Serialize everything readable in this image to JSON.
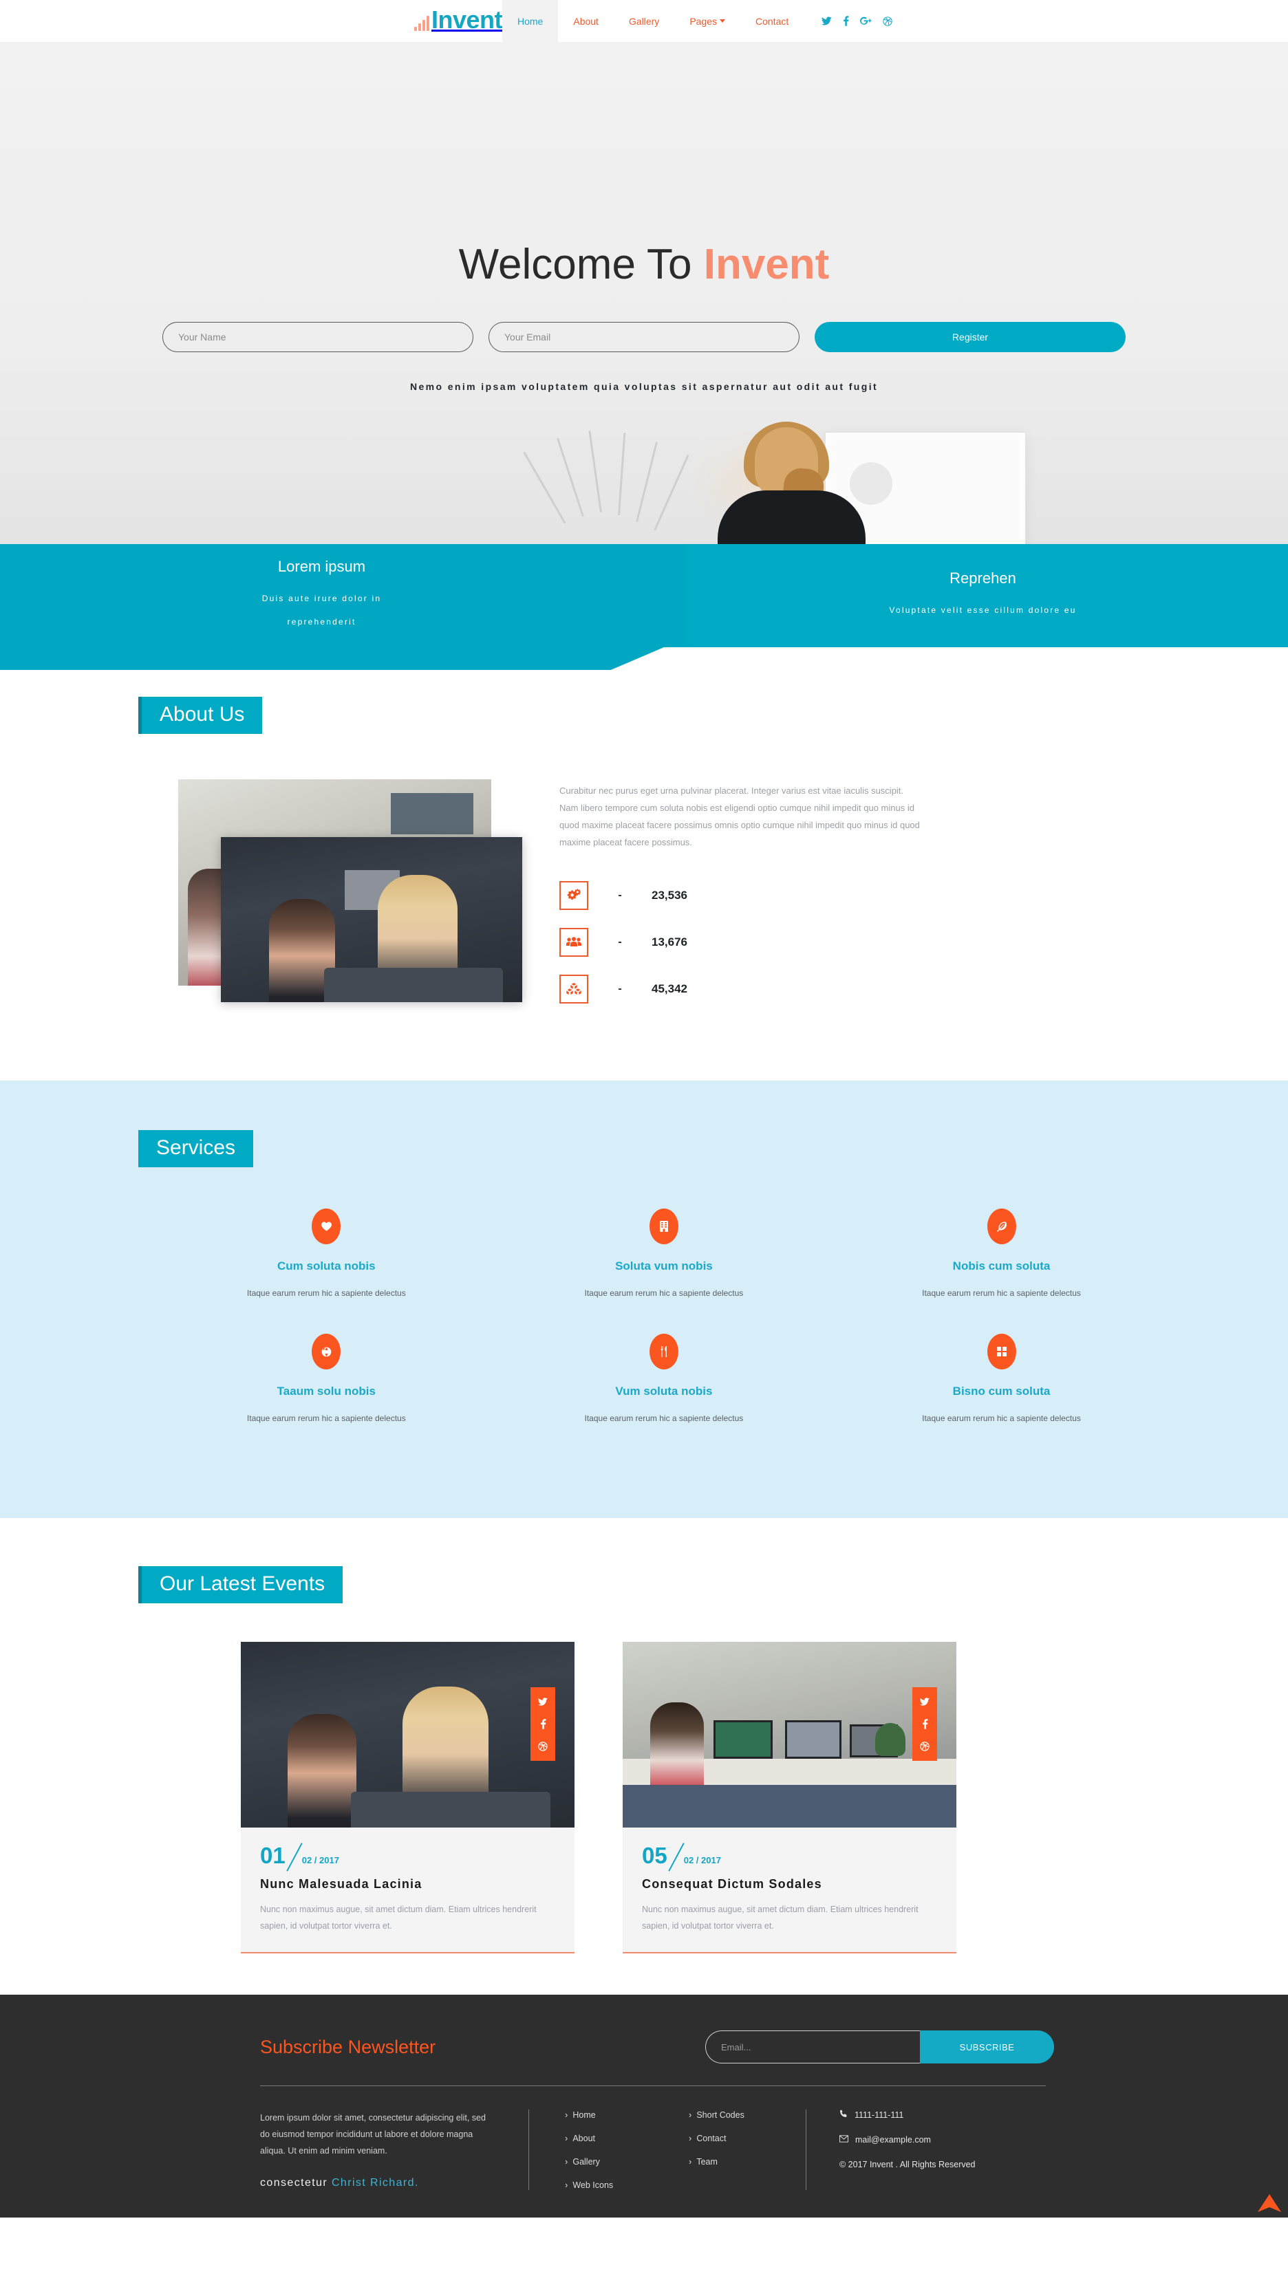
{
  "header": {
    "logo_text": "Invent",
    "nav": [
      {
        "label": "Home",
        "active": true
      },
      {
        "label": "About",
        "active": false
      },
      {
        "label": "Gallery",
        "active": false
      },
      {
        "label": "Pages",
        "active": false,
        "has_caret": true
      },
      {
        "label": "Contact",
        "active": false
      }
    ],
    "social": [
      "twitter-icon",
      "facebook-icon",
      "google-plus-icon",
      "dribbble-icon"
    ]
  },
  "hero": {
    "title_plain": "Welcome To ",
    "title_accent": "Invent",
    "name_placeholder": "Your Name",
    "email_placeholder": "Your Email",
    "name_value": "",
    "email_value": "",
    "register_label": "Register",
    "tagline": "Nemo enim ipsam voluptatem quia voluptas sit aspernatur aut odit aut fugit"
  },
  "banner": {
    "left": {
      "title": "Lorem ipsum",
      "line1": "Duis aute irure dolor in",
      "line2": "reprehenderit"
    },
    "right": {
      "title": "Reprehen",
      "line1": "Voluptate velit esse cillum dolore eu",
      "line2": ""
    }
  },
  "about": {
    "title": "About Us",
    "paragraph": "Curabitur nec purus eget urna pulvinar placerat. Integer varius est vitae iaculis suscipit. Nam libero tempore cum soluta nobis est eligendi optio cumque nihil impedit quo minus id quod maxime placeat facere possimus omnis optio cumque nihil impedit quo minus id quod maxime placeat facere possimus.",
    "stats": [
      {
        "icon": "gears-icon",
        "dash": "-",
        "value": "23,536"
      },
      {
        "icon": "users-icon",
        "dash": "-",
        "value": "13,676"
      },
      {
        "icon": "cubes-icon",
        "dash": "-",
        "value": "45,342"
      }
    ]
  },
  "services": {
    "title": "Services",
    "items": [
      {
        "icon": "heart-icon",
        "title": "Cum soluta nobis",
        "desc": "Itaque earum rerum hic a sapiente delectus"
      },
      {
        "icon": "building-icon",
        "title": "Soluta vum nobis",
        "desc": "Itaque earum rerum hic a sapiente delectus"
      },
      {
        "icon": "feather-icon",
        "title": "Nobis cum soluta",
        "desc": "Itaque earum rerum hic a sapiente delectus"
      },
      {
        "icon": "globe-icon",
        "title": "Taaum solu nobis",
        "desc": "Itaque earum rerum hic a sapiente delectus"
      },
      {
        "icon": "cutlery-icon",
        "title": "Vum soluta nobis",
        "desc": "Itaque earum rerum hic a sapiente delectus"
      },
      {
        "icon": "grid-icon",
        "title": "Bisno cum soluta",
        "desc": "Itaque earum rerum hic a sapiente delectus"
      }
    ]
  },
  "events": {
    "title": "Our Latest Events",
    "social": [
      "twitter-icon",
      "facebook-icon",
      "dribbble-icon"
    ],
    "cards": [
      {
        "number": "01",
        "date": "02 / 2017",
        "title": "Nunc Malesuada Lacinia",
        "desc": "Nunc non maximus augue, sit amet dictum diam. Etiam ultrices hendrerit sapien, id volutpat tortor viverra et."
      },
      {
        "number": "05",
        "date": "02 / 2017",
        "title": "Consequat Dictum Sodales",
        "desc": "Nunc non maximus augue, sit amet dictum diam. Etiam ultrices hendrerit sapien, id volutpat tortor viverra et."
      }
    ]
  },
  "footer": {
    "newsletter_title": "Subscribe Newsletter",
    "email_placeholder": "Email...",
    "email_value": "",
    "subscribe_label": "SUBSCRIBE",
    "about_text": "Lorem ipsum dolor sit amet, consectetur adipiscing elit, sed do eiusmod tempor incididunt ut labore et dolore magna aliqua. Ut enim ad minim veniam.",
    "signature_plain": "consectetur ",
    "signature_accent": "Christ Richard.",
    "links_col1": [
      "Home",
      "About",
      "Gallery",
      "Web Icons"
    ],
    "links_col2": [
      "Short Codes",
      "Contact",
      "Team"
    ],
    "phone": "1111-111-111",
    "email": "mail@example.com",
    "copyright": "© 2017 Invent . All Rights Reserved"
  },
  "colors": {
    "cyan": "#00a9c4",
    "orange": "#fb5620",
    "salmon": "#f78d6e",
    "dark": "#2e2e2e",
    "light_blue": "#d7edf7"
  }
}
